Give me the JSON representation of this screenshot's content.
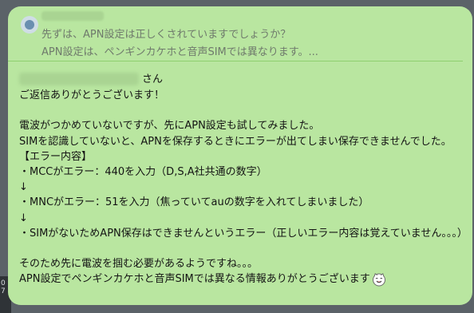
{
  "quoted": {
    "line1": "先ずは、APN設定は正しくされていますでしょうか？",
    "line2": "APN設定は、ペンギンカケホと音声SIMでは異なります。..."
  },
  "message": {
    "mention_suffix": "さん",
    "lines": [
      "ご返信ありがとうございます！",
      "",
      "電波がつかめていないですが、先にAPN設定も試してみました。",
      "SIMを認識していないと、APNを保存するときにエラーが出てしまい保存できませんでした。",
      "【エラー内容】",
      "・MCCがエラー：440を入力（D,S,A社共通の数字）",
      "↓",
      "・MNCがエラー：51を入力（焦っていてauの数字を入れてしまいました）",
      "↓",
      "・SIMがないためAPN保存はできませんというエラー（正しいエラー内容は覚えていません。。。）",
      "",
      "そのため先に電波を掴む必要があるようですね。。。",
      "APN設定でペンギンカケホと音声SIMでは異なる情報ありがとうございます"
    ],
    "emoji_icon": "smiling-cat-emoji-icon"
  },
  "background_side_text": "0\n7"
}
